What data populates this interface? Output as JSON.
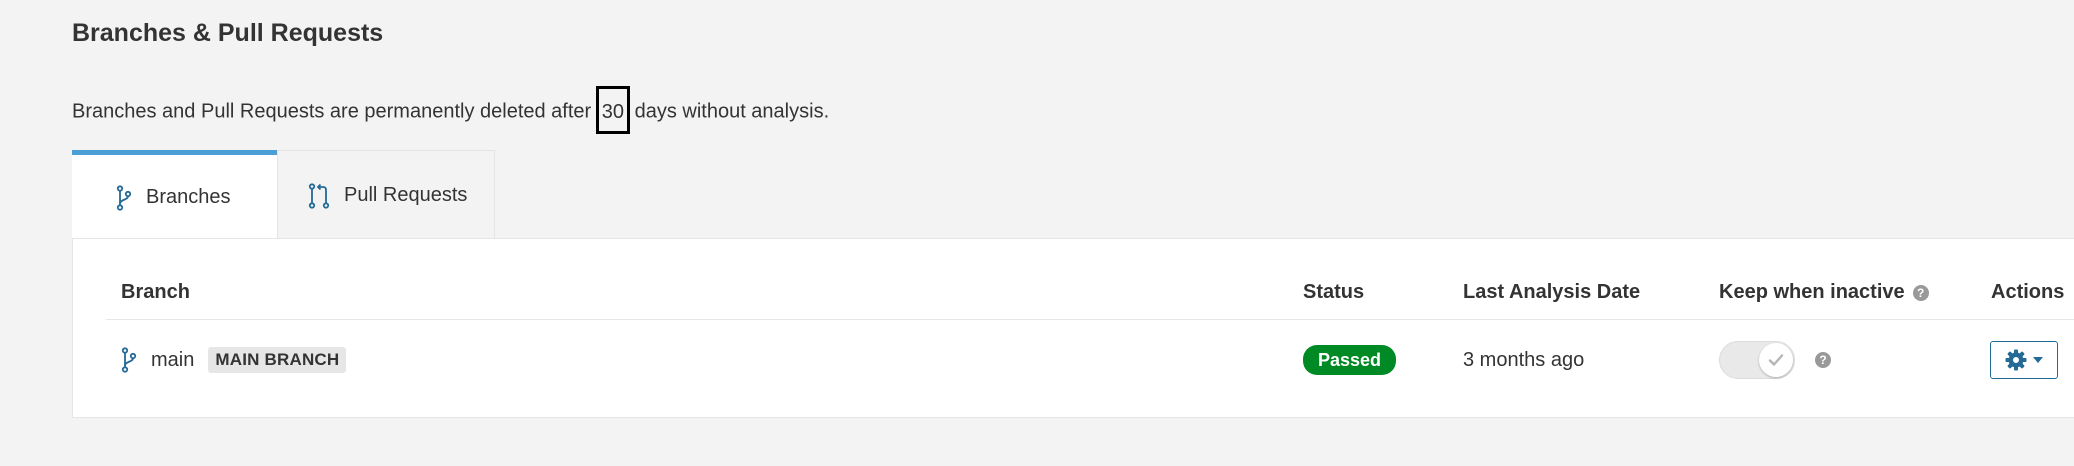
{
  "header": {
    "title": "Branches & Pull Requests"
  },
  "description": {
    "before": "Branches and Pull Requests are permanently deleted after",
    "days": "30",
    "after": "days without analysis."
  },
  "tabs": [
    {
      "label": "Branches",
      "active": true,
      "icon": "branch-icon"
    },
    {
      "label": "Pull Requests",
      "active": false,
      "icon": "pull-request-icon"
    }
  ],
  "table": {
    "columns": {
      "branch": "Branch",
      "status": "Status",
      "last_analysis": "Last Analysis Date",
      "keep_inactive": "Keep when inactive",
      "actions": "Actions"
    },
    "rows": [
      {
        "branch": "main",
        "badge": "MAIN BRANCH",
        "status": "Passed",
        "last_analysis": "3 months ago",
        "keep_inactive": true
      }
    ]
  },
  "colors": {
    "tab_accent": "#4b9fd5",
    "passed": "#008a25",
    "icon_blue": "#236a97"
  },
  "icons": {
    "help": "question-circle-icon",
    "settings": "gear-icon",
    "dropdown": "caret-down-icon",
    "check": "check-icon"
  }
}
